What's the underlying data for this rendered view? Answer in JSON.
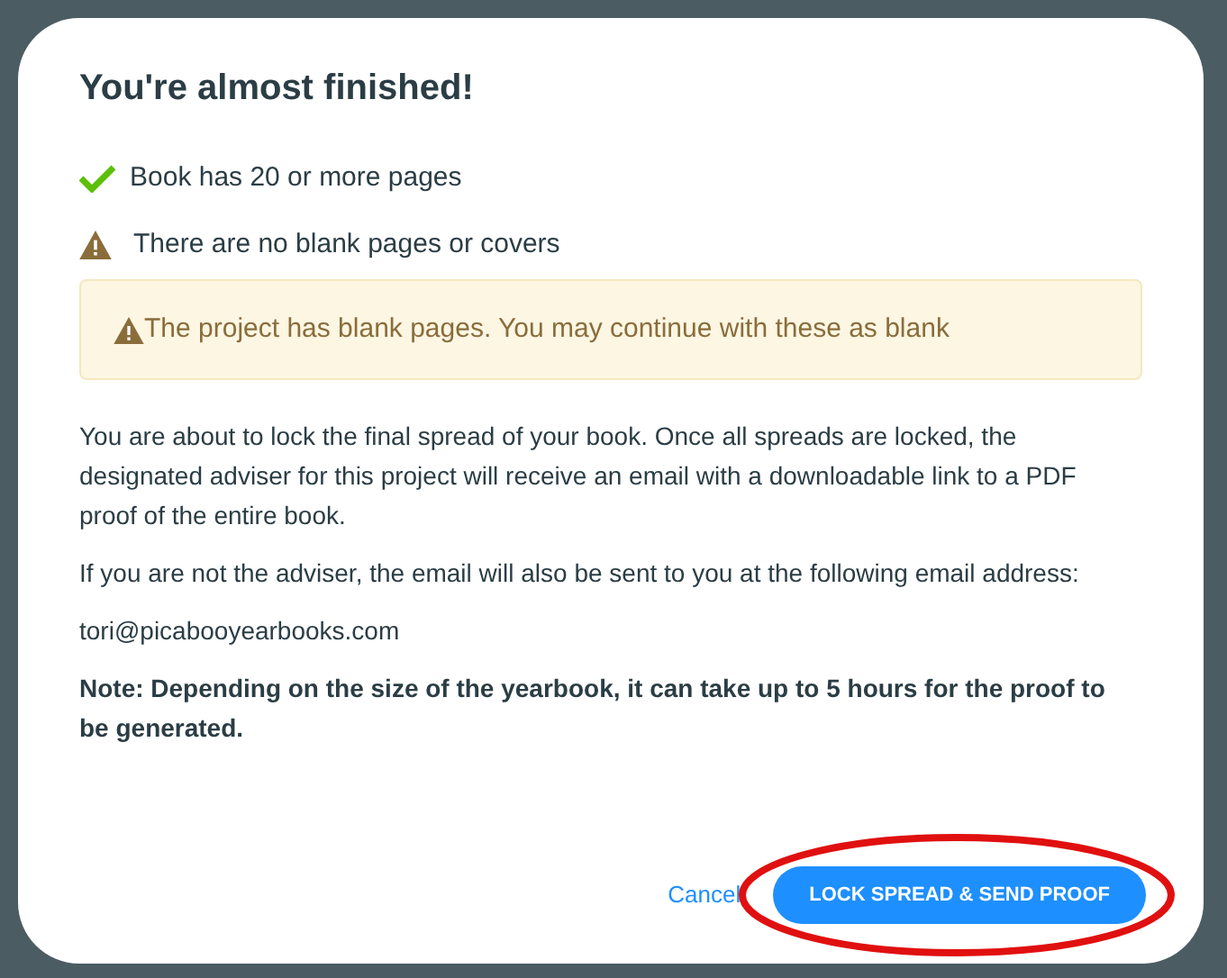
{
  "dialog": {
    "title": "You're almost finished!",
    "checks": [
      {
        "kind": "passed",
        "label": "Book has 20 or more pages"
      },
      {
        "kind": "warning",
        "label": "There are no blank pages or covers"
      }
    ],
    "alert": {
      "text": "The project has blank pages. You may continue with these as blank"
    },
    "paragraphs": [
      {
        "text": "You are about to lock the final spread of your book. Once all spreads are locked, the designated adviser for this project will receive an email with a downloadable link to a PDF proof of the entire book."
      },
      {
        "text": "If you are not the adviser, the email will also be sent to you at the following email address:"
      },
      {
        "text": "tori@picabooyearbooks.com"
      },
      {
        "text": "Note: Depending on the size of the yearbook, it can take up to 5 hours for the proof to be generated.",
        "bold": true
      }
    ],
    "cancel": "Cancel",
    "confirm": "LOCK SPREAD & SEND PROOF",
    "confirm_circled": true
  }
}
